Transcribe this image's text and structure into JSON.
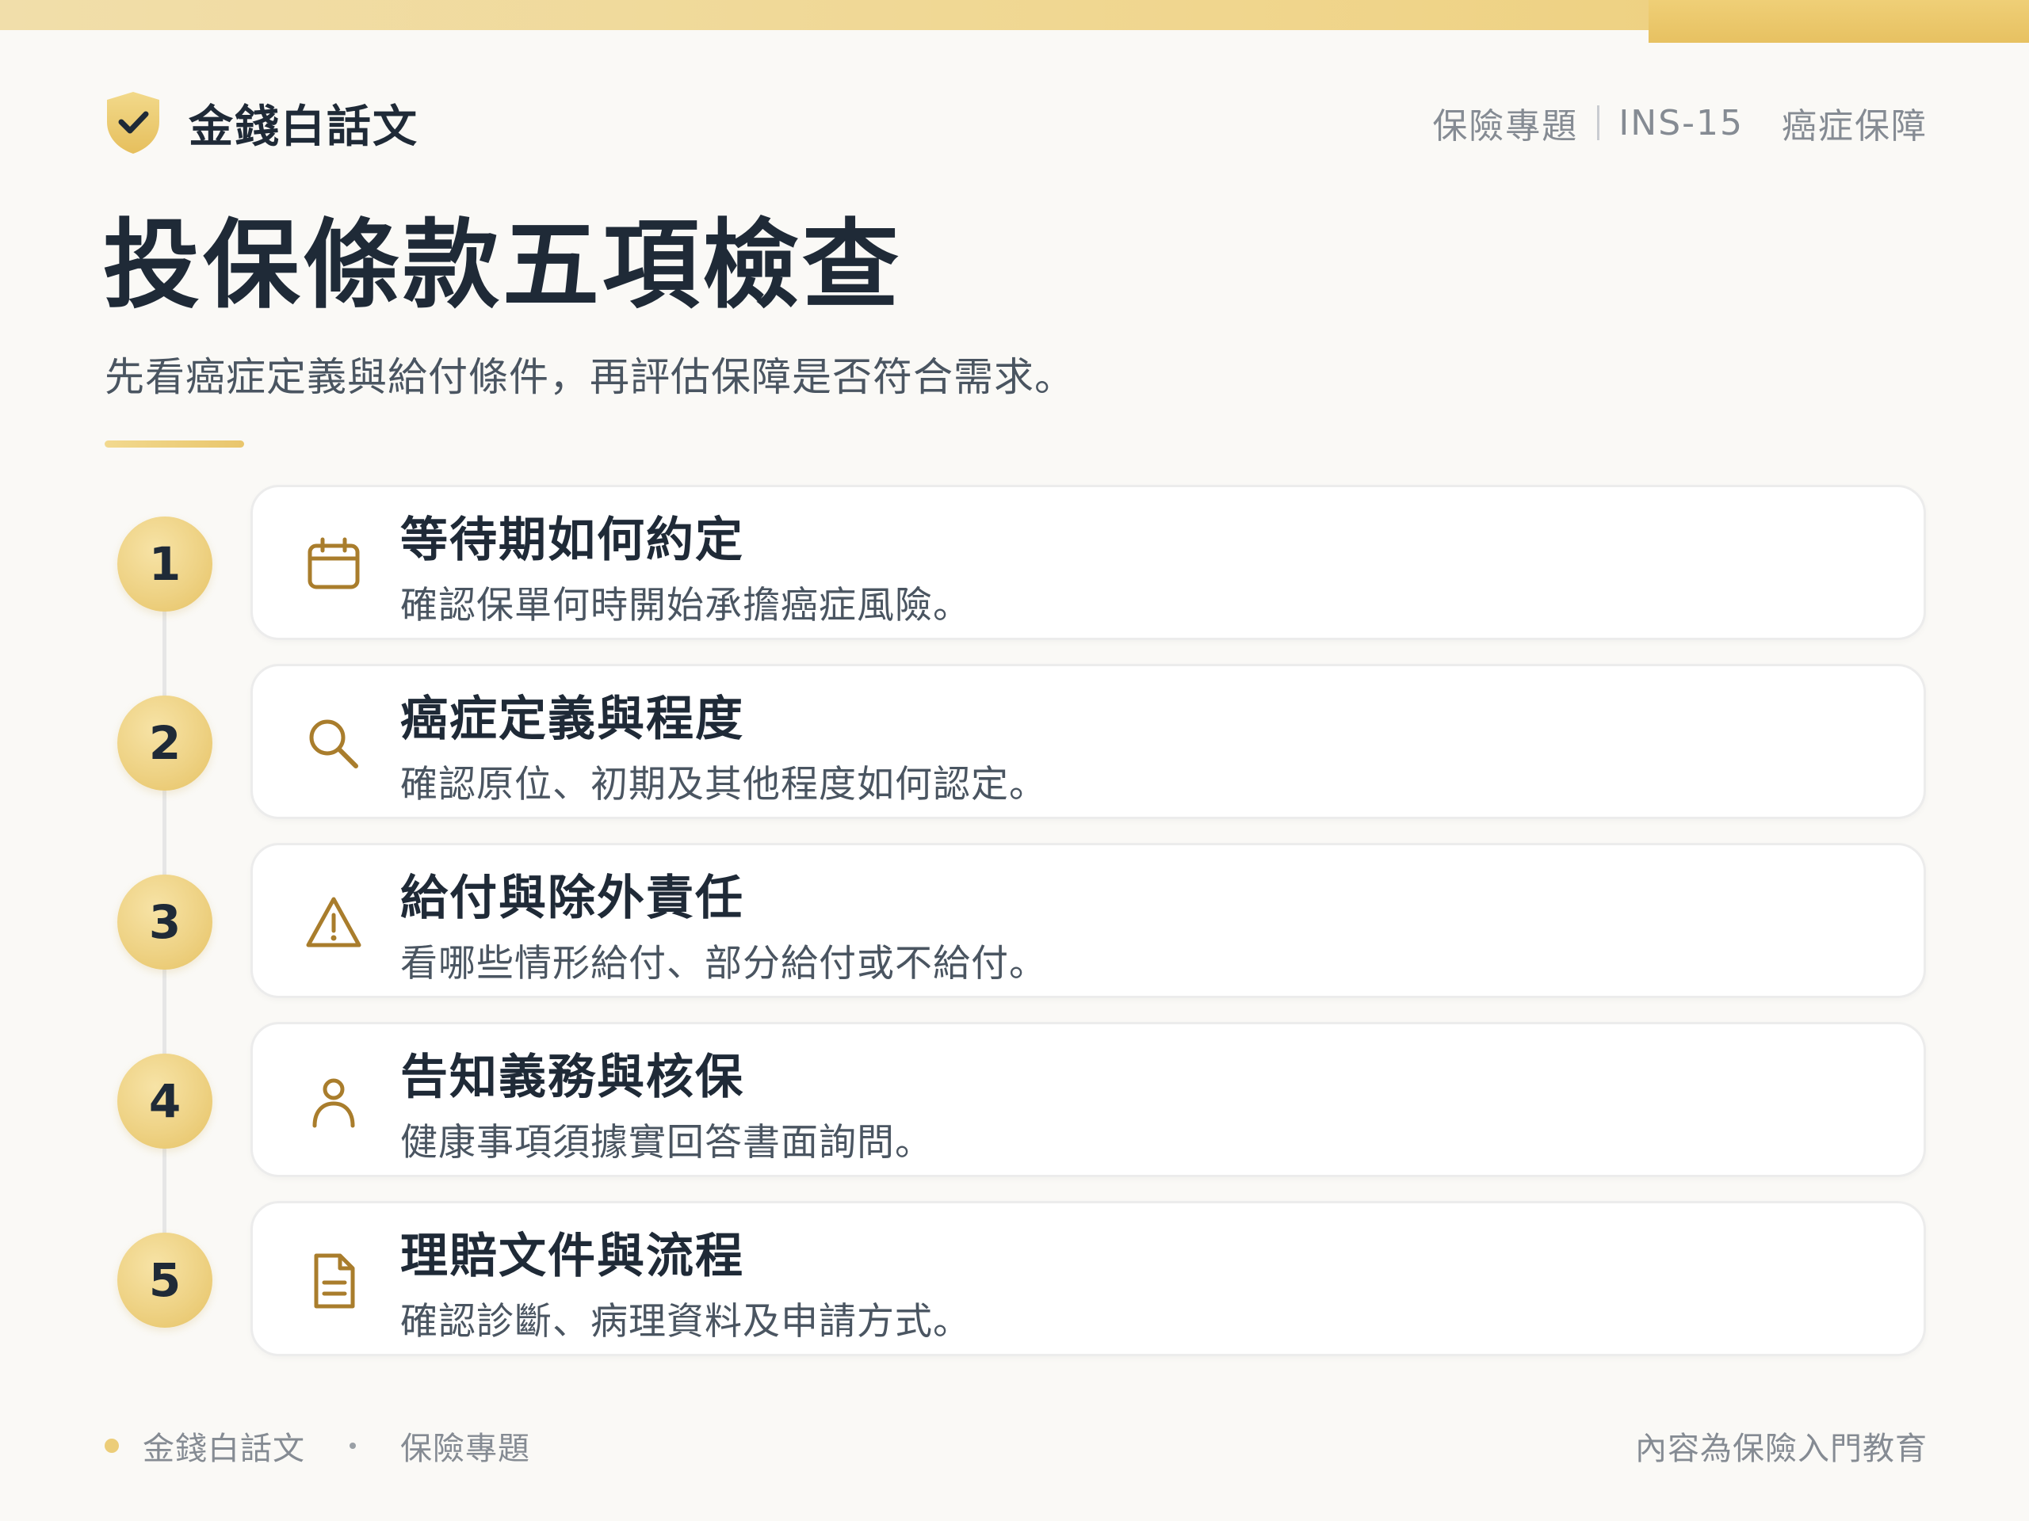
{
  "brand": {
    "name": "金錢白話文",
    "icon": "shield-check-icon"
  },
  "meta": {
    "category": "保險專題",
    "code": "INS-15",
    "topic": "癌症保障"
  },
  "page": {
    "title": "投保條款五項檢查",
    "subtitle": "先看癌症定義與給付條件，再評估保障是否符合需求。"
  },
  "items": [
    {
      "number": "1",
      "icon": "calendar-icon",
      "title": "等待期如何約定",
      "desc": "確認保單何時開始承擔癌症風險。"
    },
    {
      "number": "2",
      "icon": "search-icon",
      "title": "癌症定義與程度",
      "desc": "確認原位、初期及其他程度如何認定。"
    },
    {
      "number": "3",
      "icon": "warning-icon",
      "title": "給付與除外責任",
      "desc": "看哪些情形給付、部分給付或不給付。"
    },
    {
      "number": "4",
      "icon": "person-icon",
      "title": "告知義務與核保",
      "desc": "健康事項須據實回答書面詢問。"
    },
    {
      "number": "5",
      "icon": "document-icon",
      "title": "理賠文件與流程",
      "desc": "確認診斷、病理資料及申請方式。"
    }
  ],
  "footer": {
    "brand": "金錢白話文",
    "category": "保險專題",
    "note": "內容為保險入門教育"
  },
  "colors": {
    "accent": "#eccd79",
    "icon": "#a97d2c",
    "text": "#1f2a37",
    "muted": "#858b93"
  }
}
